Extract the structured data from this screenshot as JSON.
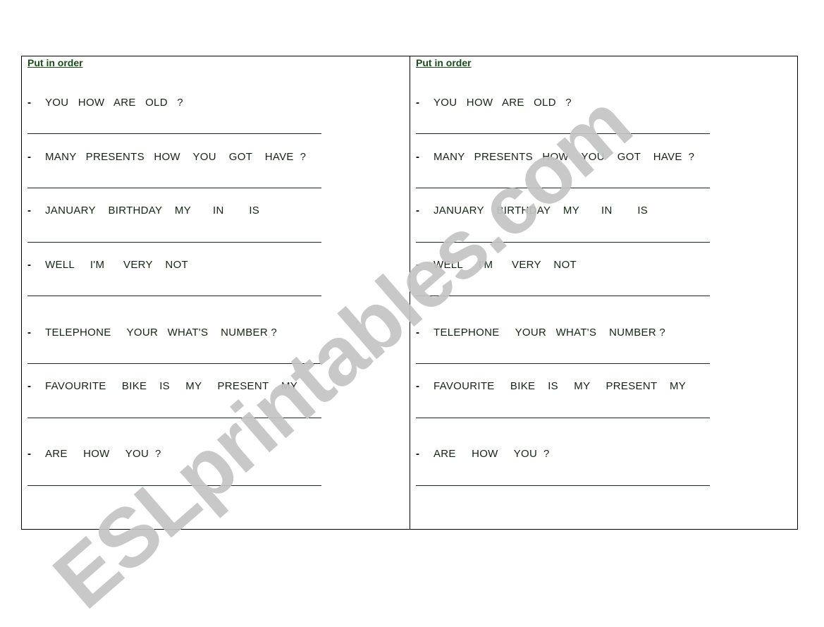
{
  "worksheet": {
    "columns": [
      {
        "title": "Put in order",
        "items": [
          {
            "bullet": "-",
            "text": "YOU   HOW   ARE   OLD   ?"
          },
          {
            "bullet": "-",
            "text": "MANY   PRESENTS   HOW    YOU    GOT    HAVE  ?"
          },
          {
            "bullet": "-",
            "text": "JANUARY    BIRTHDAY    MY       IN        IS"
          },
          {
            "bullet": "-",
            "text": "WELL     I'M      VERY    NOT"
          },
          {
            "bullet": "-",
            "text": "TELEPHONE     YOUR   WHAT'S    NUMBER ?"
          },
          {
            "bullet": "-",
            "text": "FAVOURITE     BIKE    IS     MY     PRESENT    MY"
          },
          {
            "bullet": "-",
            "text": "ARE     HOW     YOU  ?"
          }
        ]
      },
      {
        "title": "Put in order",
        "items": [
          {
            "bullet": "-",
            "text": "YOU   HOW   ARE   OLD   ?"
          },
          {
            "bullet": "-",
            "text": "MANY   PRESENTS   HOW    YOU    GOT    HAVE  ?"
          },
          {
            "bullet": "-",
            "text": "JANUARY    BIRTHDAY    MY       IN        IS"
          },
          {
            "bullet": "-",
            "text": "WELL     I'M      VERY    NOT"
          },
          {
            "bullet": "-",
            "text": "TELEPHONE     YOUR   WHAT'S    NUMBER ?"
          },
          {
            "bullet": "-",
            "text": "FAVOURITE     BIKE    IS     MY     PRESENT    MY"
          },
          {
            "bullet": "-",
            "text": "ARE     HOW     YOU  ?"
          }
        ]
      }
    ]
  },
  "watermark": "ESLprintables.com",
  "colors": {
    "title": "#1a4a1a",
    "text": "#142414",
    "watermark": "#c4c4c4",
    "border": "#000000"
  }
}
